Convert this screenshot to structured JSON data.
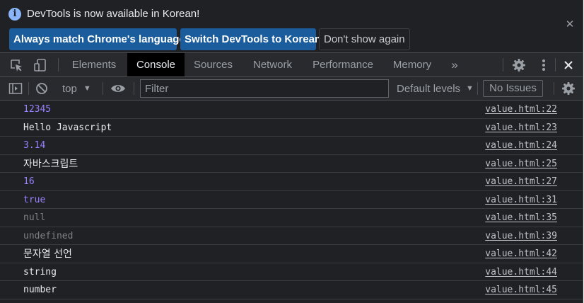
{
  "infobar": {
    "message": "DevTools is now available in Korean!",
    "buttons": {
      "match": "Always match Chrome's language",
      "switch": "Switch DevTools to Korean",
      "dont_show": "Don't show again"
    },
    "close_icon": "close-icon"
  },
  "tabs": {
    "items": [
      "Elements",
      "Console",
      "Sources",
      "Network",
      "Performance",
      "Memory"
    ],
    "active": "Console",
    "more": "»",
    "icons": [
      "inspect-element-icon",
      "device-toolbar-icon",
      "settings-gear-icon",
      "more-vertical-icon",
      "close-icon"
    ]
  },
  "toolbar": {
    "context": "top",
    "filter_placeholder": "Filter",
    "levels": "Default levels",
    "issues": "No Issues",
    "icons": [
      "sidebar-toggle-icon",
      "clear-console-icon",
      "eye-icon",
      "console-settings-icon"
    ]
  },
  "console": {
    "rows": [
      {
        "text": "12345",
        "source": "value.html:22",
        "kind": "number"
      },
      {
        "text": "Hello Javascript",
        "source": "value.html:23",
        "kind": "string"
      },
      {
        "text": "3.14",
        "source": "value.html:24",
        "kind": "number"
      },
      {
        "text": "자바스크립트",
        "source": "value.html:25",
        "kind": "string"
      },
      {
        "text": "16",
        "source": "value.html:27",
        "kind": "number"
      },
      {
        "text": "true",
        "source": "value.html:31",
        "kind": "bool"
      },
      {
        "text": "null",
        "source": "value.html:35",
        "kind": "null"
      },
      {
        "text": "undefined",
        "source": "value.html:39",
        "kind": "null"
      },
      {
        "text": "문자열 선언",
        "source": "value.html:42",
        "kind": "string"
      },
      {
        "text": "string",
        "source": "value.html:44",
        "kind": "string"
      },
      {
        "text": "number",
        "source": "value.html:45",
        "kind": "string"
      }
    ]
  },
  "colors": {
    "background": "#202124",
    "number": "#9980ff",
    "null": "#7f8184",
    "primary_button": "#1b5d9c"
  }
}
